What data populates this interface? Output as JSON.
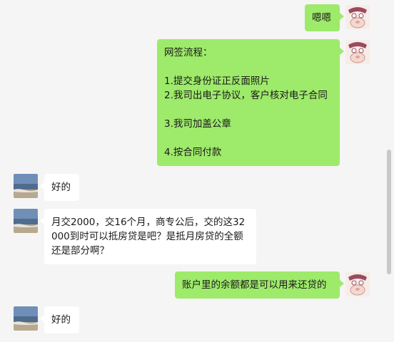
{
  "messages": [
    {
      "sender": "me",
      "lines": [
        "嗯嗯"
      ]
    },
    {
      "sender": "me",
      "lines": [
        "网签流程：",
        "",
        "1.提交身份证正反面照片",
        "2.我司出电子协议，客户核对电子合同",
        "",
        "3.我司加盖公章",
        "",
        "4.按合同付款"
      ]
    },
    {
      "sender": "other",
      "lines": [
        "好的"
      ]
    },
    {
      "sender": "other",
      "lines": [
        "月交2000，交16个月，商专公后，交的这32",
        "000到时可以抵房贷是吧？是抵月房贷的全额",
        "还是部分啊？"
      ]
    },
    {
      "sender": "me",
      "lines": [
        "账户里的余额都是可以用来还贷的"
      ]
    },
    {
      "sender": "other",
      "lines": [
        "好的"
      ]
    }
  ],
  "icons": {
    "me_avatar": "cartoon-avatar-icon",
    "other_avatar": "beach-photo-avatar"
  },
  "colors": {
    "me_bubble": "#9eea6a",
    "other_bubble": "#ffffff",
    "background": "#f5f5f5"
  }
}
